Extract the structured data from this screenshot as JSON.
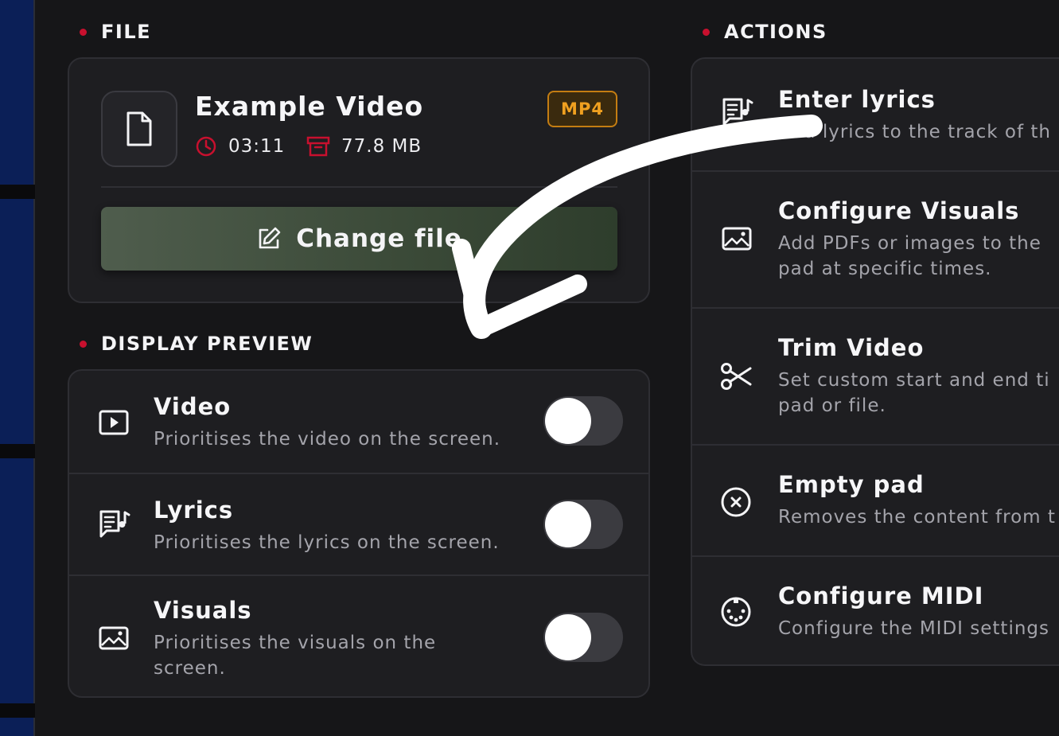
{
  "file_section": {
    "title": "FILE",
    "file_name": "Example Video",
    "duration": "03:11",
    "size": "77.8 MB",
    "format_badge": "MP4",
    "change_button": "Change file"
  },
  "preview_section": {
    "title": "DISPLAY PREVIEW",
    "items": [
      {
        "title": "Video",
        "description": "Prioritises the video on the screen.",
        "icon": "play-square-icon",
        "enabled": false
      },
      {
        "title": "Lyrics",
        "description": "Prioritises the lyrics on the screen.",
        "icon": "lyrics-icon",
        "enabled": false
      },
      {
        "title": "Visuals",
        "description": "Prioritises the visuals on the screen.",
        "icon": "image-icon",
        "enabled": false
      }
    ]
  },
  "actions_section": {
    "title": "ACTIONS",
    "items": [
      {
        "title": "Enter lyrics",
        "description": "Add lyrics to the track of th",
        "icon": "lyrics-icon"
      },
      {
        "title": "Configure Visuals",
        "description": "Add PDFs or images to the pad at specific times.",
        "icon": "image-icon"
      },
      {
        "title": "Trim Video",
        "description": "Set custom start and end ti pad or file.",
        "icon": "scissors-icon"
      },
      {
        "title": "Empty pad",
        "description": "Removes the content from t",
        "icon": "circle-x-icon"
      },
      {
        "title": "Configure MIDI",
        "description": "Configure the MIDI settings",
        "icon": "midi-icon"
      }
    ]
  },
  "colors": {
    "accent_red": "#c8102e",
    "badge_orange": "#f0a020",
    "background": "#161618",
    "card": "#1e1e21"
  }
}
